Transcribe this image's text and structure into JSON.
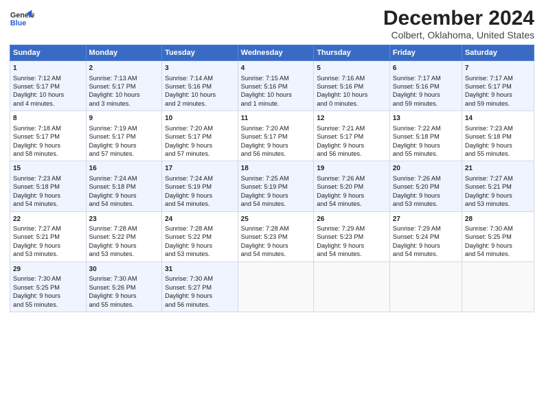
{
  "logo": {
    "line1": "General",
    "line2": "Blue"
  },
  "title": "December 2024",
  "subtitle": "Colbert, Oklahoma, United States",
  "days_of_week": [
    "Sunday",
    "Monday",
    "Tuesday",
    "Wednesday",
    "Thursday",
    "Friday",
    "Saturday"
  ],
  "weeks": [
    [
      {
        "day": 1,
        "info": "Sunrise: 7:12 AM\nSunset: 5:17 PM\nDaylight: 10 hours\nand 4 minutes."
      },
      {
        "day": 2,
        "info": "Sunrise: 7:13 AM\nSunset: 5:17 PM\nDaylight: 10 hours\nand 3 minutes."
      },
      {
        "day": 3,
        "info": "Sunrise: 7:14 AM\nSunset: 5:16 PM\nDaylight: 10 hours\nand 2 minutes."
      },
      {
        "day": 4,
        "info": "Sunrise: 7:15 AM\nSunset: 5:16 PM\nDaylight: 10 hours\nand 1 minute."
      },
      {
        "day": 5,
        "info": "Sunrise: 7:16 AM\nSunset: 5:16 PM\nDaylight: 10 hours\nand 0 minutes."
      },
      {
        "day": 6,
        "info": "Sunrise: 7:17 AM\nSunset: 5:16 PM\nDaylight: 9 hours\nand 59 minutes."
      },
      {
        "day": 7,
        "info": "Sunrise: 7:17 AM\nSunset: 5:17 PM\nDaylight: 9 hours\nand 59 minutes."
      }
    ],
    [
      {
        "day": 8,
        "info": "Sunrise: 7:18 AM\nSunset: 5:17 PM\nDaylight: 9 hours\nand 58 minutes."
      },
      {
        "day": 9,
        "info": "Sunrise: 7:19 AM\nSunset: 5:17 PM\nDaylight: 9 hours\nand 57 minutes."
      },
      {
        "day": 10,
        "info": "Sunrise: 7:20 AM\nSunset: 5:17 PM\nDaylight: 9 hours\nand 57 minutes."
      },
      {
        "day": 11,
        "info": "Sunrise: 7:20 AM\nSunset: 5:17 PM\nDaylight: 9 hours\nand 56 minutes."
      },
      {
        "day": 12,
        "info": "Sunrise: 7:21 AM\nSunset: 5:17 PM\nDaylight: 9 hours\nand 56 minutes."
      },
      {
        "day": 13,
        "info": "Sunrise: 7:22 AM\nSunset: 5:18 PM\nDaylight: 9 hours\nand 55 minutes."
      },
      {
        "day": 14,
        "info": "Sunrise: 7:23 AM\nSunset: 5:18 PM\nDaylight: 9 hours\nand 55 minutes."
      }
    ],
    [
      {
        "day": 15,
        "info": "Sunrise: 7:23 AM\nSunset: 5:18 PM\nDaylight: 9 hours\nand 54 minutes."
      },
      {
        "day": 16,
        "info": "Sunrise: 7:24 AM\nSunset: 5:18 PM\nDaylight: 9 hours\nand 54 minutes."
      },
      {
        "day": 17,
        "info": "Sunrise: 7:24 AM\nSunset: 5:19 PM\nDaylight: 9 hours\nand 54 minutes."
      },
      {
        "day": 18,
        "info": "Sunrise: 7:25 AM\nSunset: 5:19 PM\nDaylight: 9 hours\nand 54 minutes."
      },
      {
        "day": 19,
        "info": "Sunrise: 7:26 AM\nSunset: 5:20 PM\nDaylight: 9 hours\nand 54 minutes."
      },
      {
        "day": 20,
        "info": "Sunrise: 7:26 AM\nSunset: 5:20 PM\nDaylight: 9 hours\nand 53 minutes."
      },
      {
        "day": 21,
        "info": "Sunrise: 7:27 AM\nSunset: 5:21 PM\nDaylight: 9 hours\nand 53 minutes."
      }
    ],
    [
      {
        "day": 22,
        "info": "Sunrise: 7:27 AM\nSunset: 5:21 PM\nDaylight: 9 hours\nand 53 minutes."
      },
      {
        "day": 23,
        "info": "Sunrise: 7:28 AM\nSunset: 5:22 PM\nDaylight: 9 hours\nand 53 minutes."
      },
      {
        "day": 24,
        "info": "Sunrise: 7:28 AM\nSunset: 5:22 PM\nDaylight: 9 hours\nand 53 minutes."
      },
      {
        "day": 25,
        "info": "Sunrise: 7:28 AM\nSunset: 5:23 PM\nDaylight: 9 hours\nand 54 minutes."
      },
      {
        "day": 26,
        "info": "Sunrise: 7:29 AM\nSunset: 5:23 PM\nDaylight: 9 hours\nand 54 minutes."
      },
      {
        "day": 27,
        "info": "Sunrise: 7:29 AM\nSunset: 5:24 PM\nDaylight: 9 hours\nand 54 minutes."
      },
      {
        "day": 28,
        "info": "Sunrise: 7:30 AM\nSunset: 5:25 PM\nDaylight: 9 hours\nand 54 minutes."
      }
    ],
    [
      {
        "day": 29,
        "info": "Sunrise: 7:30 AM\nSunset: 5:25 PM\nDaylight: 9 hours\nand 55 minutes."
      },
      {
        "day": 30,
        "info": "Sunrise: 7:30 AM\nSunset: 5:26 PM\nDaylight: 9 hours\nand 55 minutes."
      },
      {
        "day": 31,
        "info": "Sunrise: 7:30 AM\nSunset: 5:27 PM\nDaylight: 9 hours\nand 56 minutes."
      },
      null,
      null,
      null,
      null
    ]
  ]
}
